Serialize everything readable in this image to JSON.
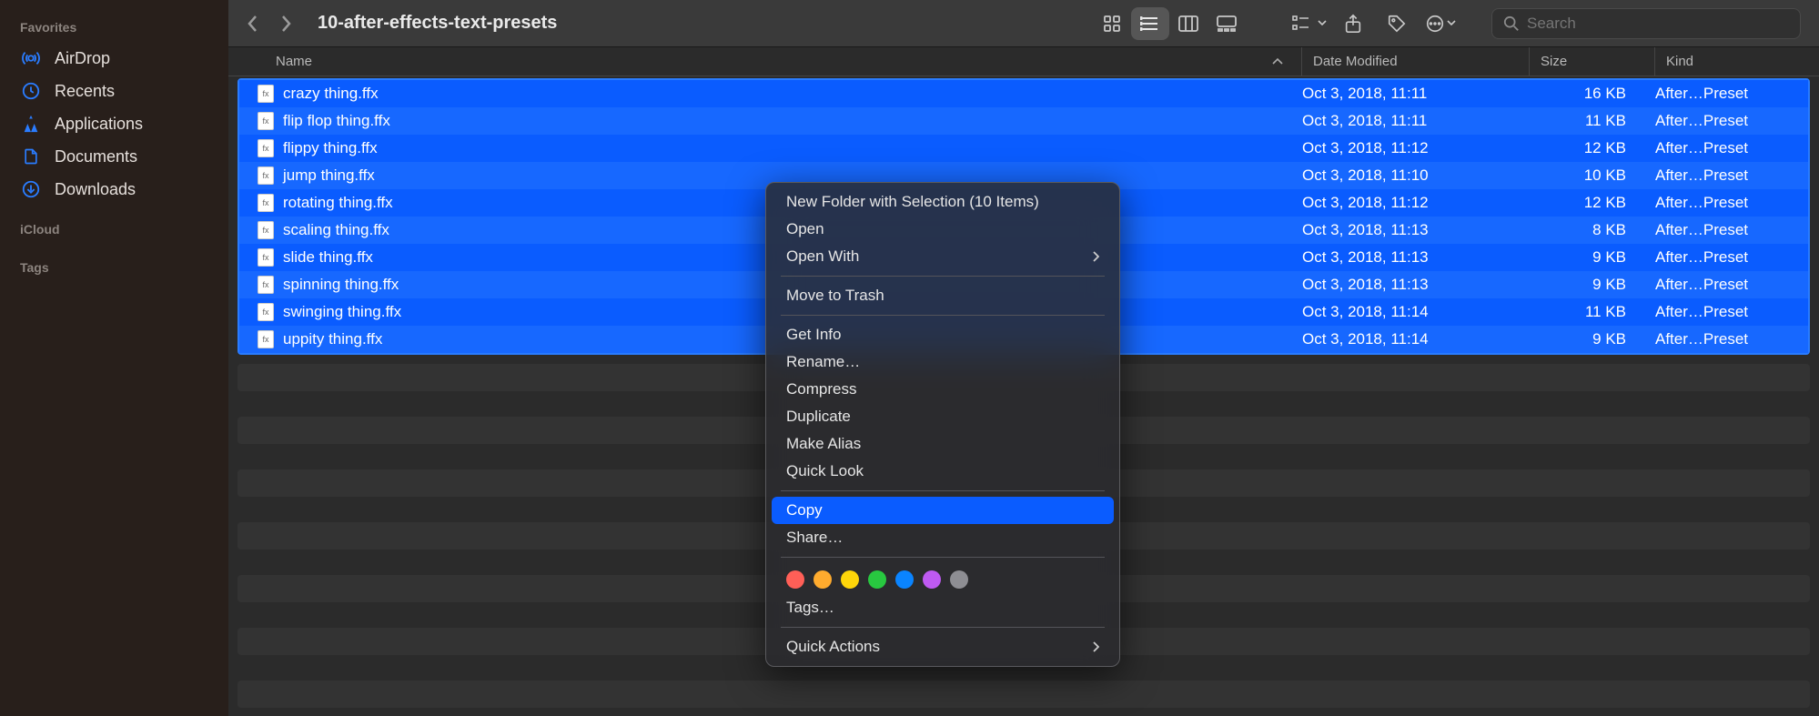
{
  "sidebar": {
    "headings": {
      "favorites": "Favorites",
      "icloud": "iCloud",
      "tags": "Tags"
    },
    "items": [
      {
        "icon": "airdrop-icon",
        "label": "AirDrop"
      },
      {
        "icon": "clock-icon",
        "label": "Recents"
      },
      {
        "icon": "apps-icon",
        "label": "Applications"
      },
      {
        "icon": "document-icon",
        "label": "Documents"
      },
      {
        "icon": "download-icon",
        "label": "Downloads"
      }
    ]
  },
  "toolbar": {
    "title": "10-after-effects-text-presets",
    "search_placeholder": "Search"
  },
  "columns": {
    "name": "Name",
    "date": "Date Modified",
    "size": "Size",
    "kind": "Kind"
  },
  "files": [
    {
      "name": "crazy thing.ffx",
      "date": "Oct 3, 2018, 11:11",
      "size": "16 KB",
      "kind": "After…Preset"
    },
    {
      "name": "flip flop thing.ffx",
      "date": "Oct 3, 2018, 11:11",
      "size": "11 KB",
      "kind": "After…Preset"
    },
    {
      "name": "flippy thing.ffx",
      "date": "Oct 3, 2018, 11:12",
      "size": "12 KB",
      "kind": "After…Preset"
    },
    {
      "name": "jump thing.ffx",
      "date": "Oct 3, 2018, 11:10",
      "size": "10 KB",
      "kind": "After…Preset"
    },
    {
      "name": "rotating thing.ffx",
      "date": "Oct 3, 2018, 11:12",
      "size": "12 KB",
      "kind": "After…Preset"
    },
    {
      "name": "scaling thing.ffx",
      "date": "Oct 3, 2018, 11:13",
      "size": "8 KB",
      "kind": "After…Preset"
    },
    {
      "name": "slide thing.ffx",
      "date": "Oct 3, 2018, 11:13",
      "size": "9 KB",
      "kind": "After…Preset"
    },
    {
      "name": "spinning thing.ffx",
      "date": "Oct 3, 2018, 11:13",
      "size": "9 KB",
      "kind": "After…Preset"
    },
    {
      "name": "swinging thing.ffx",
      "date": "Oct 3, 2018, 11:14",
      "size": "11 KB",
      "kind": "After…Preset"
    },
    {
      "name": "uppity thing.ffx",
      "date": "Oct 3, 2018, 11:14",
      "size": "9 KB",
      "kind": "After…Preset"
    }
  ],
  "context_menu": {
    "new_folder": "New Folder with Selection (10 Items)",
    "open": "Open",
    "open_with": "Open With",
    "trash": "Move to Trash",
    "get_info": "Get Info",
    "rename": "Rename…",
    "compress": "Compress",
    "duplicate": "Duplicate",
    "alias": "Make Alias",
    "quicklook": "Quick Look",
    "copy": "Copy",
    "share": "Share…",
    "tags": "Tags…",
    "quick_actions": "Quick Actions",
    "tag_colors": [
      "#ff5f57",
      "#ffab2e",
      "#ffd60a",
      "#28c840",
      "#0a84ff",
      "#bf5af2",
      "#8e8e93"
    ]
  }
}
